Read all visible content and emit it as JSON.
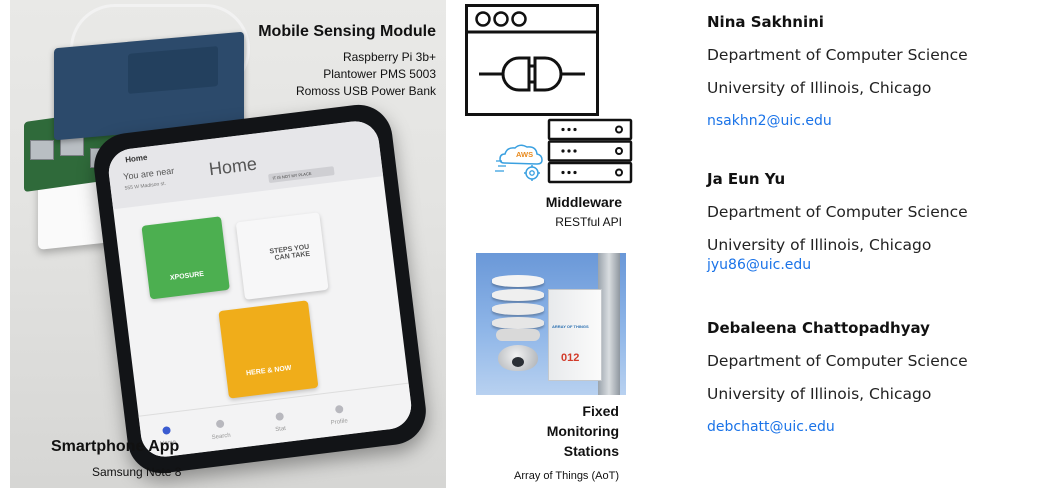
{
  "photo_panel": {
    "module_title": "Mobile Sensing Module",
    "module_components": [
      "Raspberry Pi 3b+",
      "Plantower PMS 5003",
      "Romoss USB Power Bank"
    ],
    "app_title": "Smartphone App",
    "app_device": "Samsung Note 8"
  },
  "phone_screen": {
    "app_header": "Home",
    "near_text": "You are near",
    "location_title": "Home",
    "address": "555 W Madison st.",
    "chip_label": "IT IS NOT MY PLACE",
    "tile_xposure": "XPOSURE",
    "tile_steps": "STEPS YOU CAN TAKE",
    "tile_here": "HERE & NOW",
    "nav_items": [
      "Home",
      "Search",
      "Stat",
      "Profile"
    ]
  },
  "middleware": {
    "aws_badge": "AWS",
    "title": "Middleware",
    "subtitle": "RESTful API"
  },
  "stations": {
    "title_line1": "Fixed",
    "title_line2": "Monitoring",
    "title_line3": "Stations",
    "subtitle": "Array of Things (AoT)",
    "box_label": "ARRAY OF THINGS",
    "box_number": "012"
  },
  "authors": [
    {
      "name": "Nina Sakhnini",
      "department": "Department of Computer Science",
      "university": "University of Illinois, Chicago",
      "email": "nsakhn2@uic.edu"
    },
    {
      "name": "Ja Eun Yu",
      "department": "Department of Computer Science",
      "university": "University of Illinois, Chicago",
      "email": "jyu86@uic.edu"
    },
    {
      "name": "Debaleena Chattopadhyay",
      "department": "Department of Computer Science",
      "university": "University of Illinois, Chicago",
      "email": "debchatt@uic.edu"
    }
  ],
  "colors": {
    "tile_green": "#4caf50",
    "tile_orange": "#f0ad1a",
    "link_blue": "#1a73e8"
  }
}
